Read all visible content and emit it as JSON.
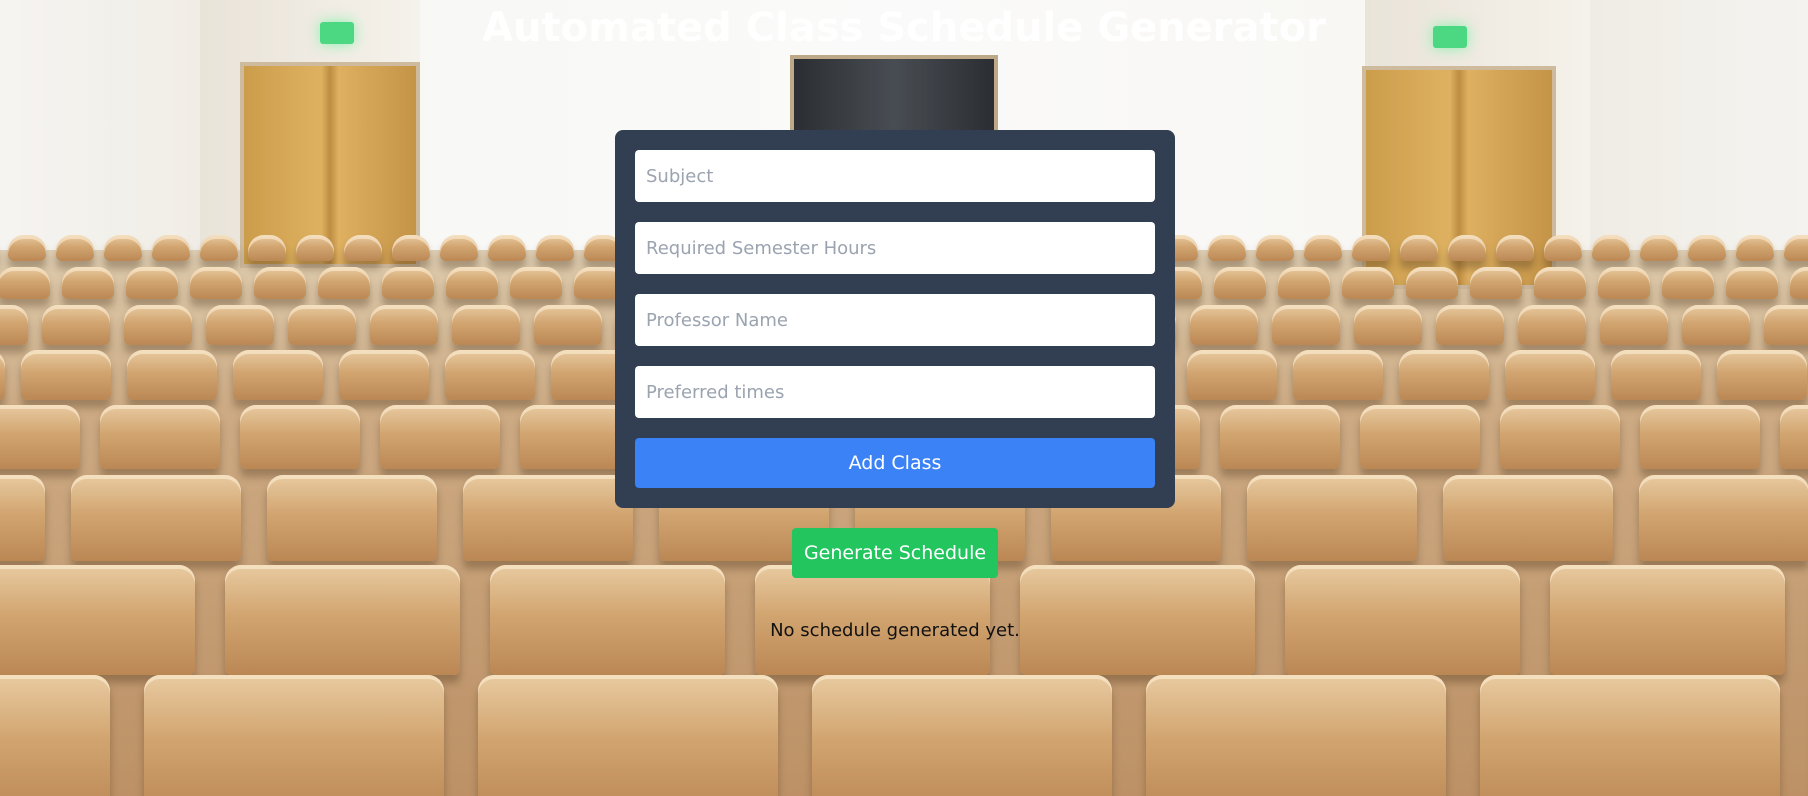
{
  "page": {
    "title": "Automated Class Schedule Generator"
  },
  "form": {
    "subject_placeholder": "Subject",
    "hours_placeholder": "Required Semester Hours",
    "professor_placeholder": "Professor Name",
    "times_placeholder": "Preferred times",
    "subject_value": "",
    "hours_value": "",
    "professor_value": "",
    "times_value": "",
    "add_label": "Add Class"
  },
  "actions": {
    "generate_label": "Generate Schedule"
  },
  "schedule": {
    "status_text": "No schedule generated yet."
  },
  "colors": {
    "card_background": "#323f53",
    "add_button": "#3b82f6",
    "generate_button": "#22c55e",
    "title_text": "#ffffff"
  }
}
